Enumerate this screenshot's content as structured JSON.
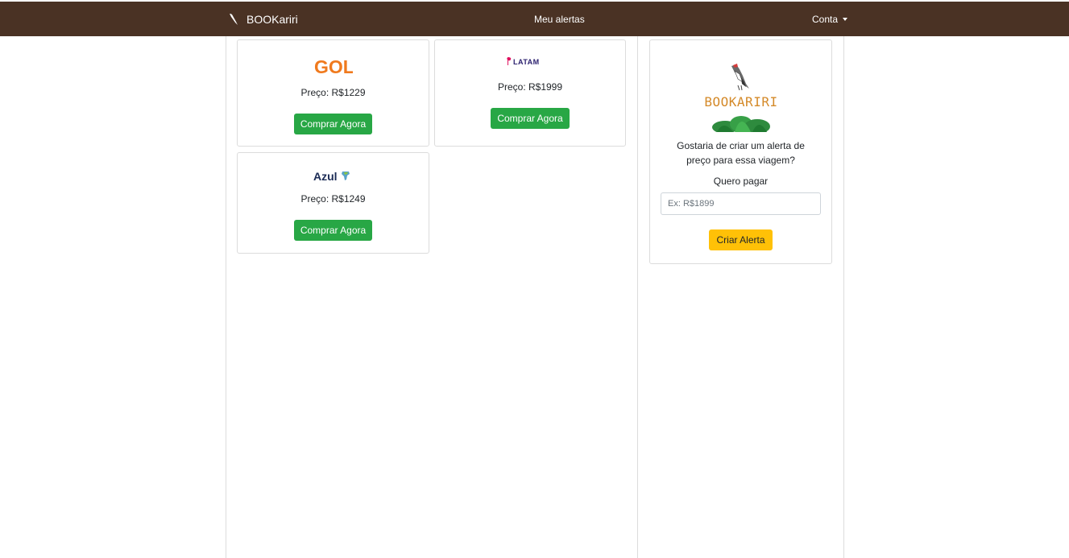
{
  "navbar": {
    "brand": "BOOKariri",
    "alerts_link": "Meu alertas",
    "account_menu": "Conta"
  },
  "flights": [
    {
      "airline": "GOL",
      "price": "Preço: R$1229",
      "button": "Comprar Agora"
    },
    {
      "airline": "LATAM",
      "price": "Preço: R$1999",
      "button": "Comprar Agora"
    },
    {
      "airline": "Azul",
      "price": "Preço: R$1249",
      "button": "Comprar Agora"
    }
  ],
  "alert": {
    "logo_text": "BOOKARIRI",
    "question": "Gostaria de criar um alerta de preço para essa viagem?",
    "label": "Quero pagar",
    "input_placeholder": "Ex: R$1899",
    "input_value": "",
    "button": "Criar Alerta"
  },
  "colors": {
    "navbar": "#4a3224",
    "buy_button": "#28a745",
    "alert_button": "#ffc107",
    "gol_brand": "#f07a1e",
    "latam_brand": "#2a1f6e",
    "latam_accent": "#e0115f",
    "azul_brand": "#1b2b55"
  },
  "icons": {
    "brand": "bird-feather-icon",
    "account_caret": "caret-down-icon"
  }
}
